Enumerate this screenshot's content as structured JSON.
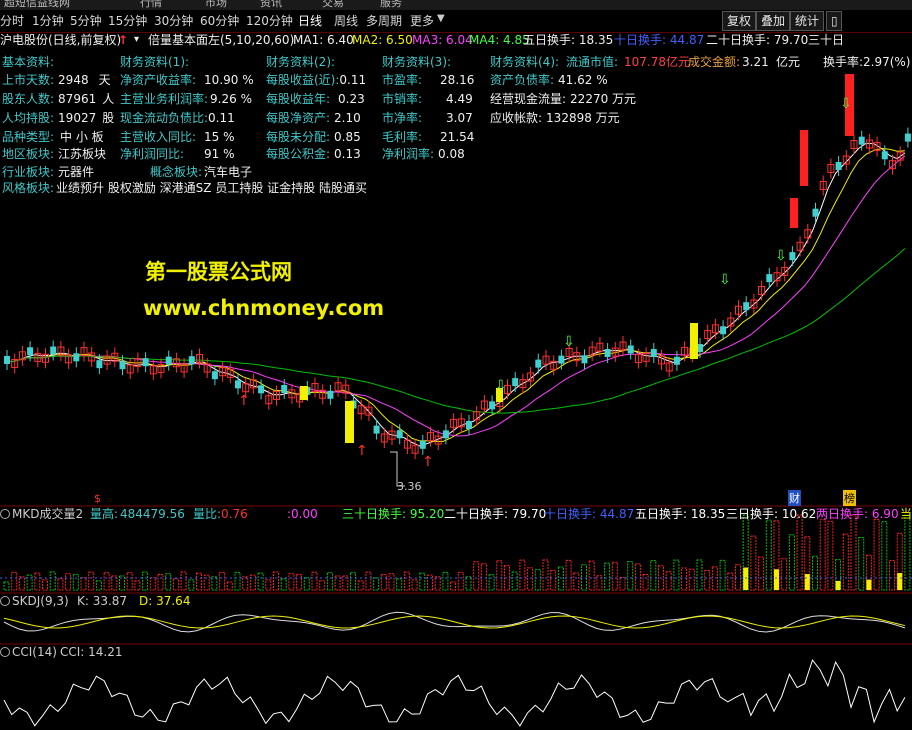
{
  "window": {
    "title": "超短信益线网"
  },
  "top_menu": [
    "行情",
    "市场",
    "资讯",
    "交易",
    "服务"
  ],
  "period_tabs": [
    "分时",
    "1分钟",
    "5分钟",
    "15分钟",
    "30分钟",
    "60分钟",
    "120分钟",
    "日线",
    "周线",
    "多周期",
    "更多"
  ],
  "active_period": "日线",
  "right_buttons": [
    "复权",
    "叠加",
    "统计"
  ],
  "info_line": {
    "stock": "沪电股份(日线,前复权)",
    "indicator": "倍量基本面左(5,10,20,60)",
    "ma1": "MA1: 6.40",
    "ma2": "MA2: 6.50",
    "ma3": "MA3: 6.04",
    "ma4": "MA4: 4.85",
    "t5": "五日换手: 18.35",
    "t10": "十日换手: 44.87",
    "t20": "二十日换手: 79.70",
    "t30": "三十日"
  },
  "fundamentals": {
    "col1_title": "基本资料:",
    "col1": [
      {
        "label": "上市天数:",
        "value": "2948",
        "unit": "天"
      },
      {
        "label": "股东人数:",
        "value": "87961",
        "unit": "人"
      },
      {
        "label": "人均持股:",
        "value": "19027",
        "unit": "股"
      },
      {
        "label": "品种类型:",
        "value": "中 小 板",
        "unit": ""
      },
      {
        "label": "地区板块:",
        "value": "江苏板块",
        "unit": ""
      },
      {
        "label": "行业板块:",
        "value": "元器件",
        "unit": ""
      }
    ],
    "col2_title": "财务资料(1):",
    "col2": [
      {
        "label": "净资产收益率:",
        "value": "10.90 %"
      },
      {
        "label": "主营业务利润率:",
        "value": "9.26 %"
      },
      {
        "label": "现金流动负债比:",
        "value": "0.11"
      },
      {
        "label": "主营收入同比:",
        "value": "15 %"
      },
      {
        "label": "净利润同比:",
        "value": "91 %"
      },
      {
        "label": "概念板块:",
        "value": "汽车电子"
      }
    ],
    "col3_title": "财务资料(2):",
    "col3": [
      {
        "label": "每股收益(近):",
        "value": "0.11"
      },
      {
        "label": "每股收益年:",
        "value": "0.23"
      },
      {
        "label": "每股净资产:",
        "value": "2.10"
      },
      {
        "label": "每股未分配:",
        "value": "0.85"
      },
      {
        "label": "每股公积金:",
        "value": "0.13"
      }
    ],
    "col4_title": "财务资料(3):",
    "col4": [
      {
        "label": "市盈率:",
        "value": "28.16"
      },
      {
        "label": "市销率:",
        "value": "4.49"
      },
      {
        "label": "市净率:",
        "value": "3.07"
      },
      {
        "label": "毛利率:",
        "value": "21.54"
      },
      {
        "label": "净利润率:",
        "value": "0.08"
      }
    ],
    "col5_title": "财务资料(4):",
    "market_value_label": "流通市值:",
    "market_value": "107.78亿元",
    "turnover_amount_label": "成交金额:",
    "turnover_amount": "3.21",
    "turnover_unit": "亿元",
    "turnover_rate_label": "换手率:",
    "turnover_rate": "2.97(%)",
    "col5": [
      {
        "label": "资产负债率:",
        "value": "41.62 %"
      },
      {
        "label": "经营现金流量:",
        "value": "22270 万元"
      },
      {
        "label": "应收帐款:",
        "value": "132898 万元"
      }
    ],
    "style_label": "风格板块:",
    "style_value": "业绩预升 股权激励 深港通SZ 员工持股 证金持股 陆股通买"
  },
  "watermark": {
    "line1": "第一股票公式网",
    "line2": "www.chnmoney.com"
  },
  "price_low_label": "3.36",
  "event_markers": {
    "s": "$",
    "cai": "财",
    "bang": "榜"
  },
  "volume_panel": {
    "name": "MKD成交量2",
    "vol_label": "量高:",
    "vol_value": "484479.56",
    "ratio_label": "量比:",
    "ratio_value": "0.76",
    "extra": ":0.00",
    "t30": "三十日换手: 95.20",
    "t20": "二十日换手: 79.70",
    "t10": "十日换手: 44.87",
    "t5": "五日换手: 18.35",
    "t3": "三日换手: 10.62",
    "t2": "两日换手: 6.90",
    "t1": "当"
  },
  "skdj_panel": {
    "name": "SKDJ(9,3)",
    "k": "K: 33.87",
    "d": "D: 37.64"
  },
  "cci_panel": {
    "name": "CCI(14)",
    "value": "CCI: 14.21"
  },
  "colors": {
    "up": "#ff3030",
    "down": "#40d0d0",
    "ma5": "#ffffff",
    "ma10": "#f0f000",
    "ma20": "#ff40ff",
    "ma60": "#00c000",
    "bg": "#000000"
  }
}
